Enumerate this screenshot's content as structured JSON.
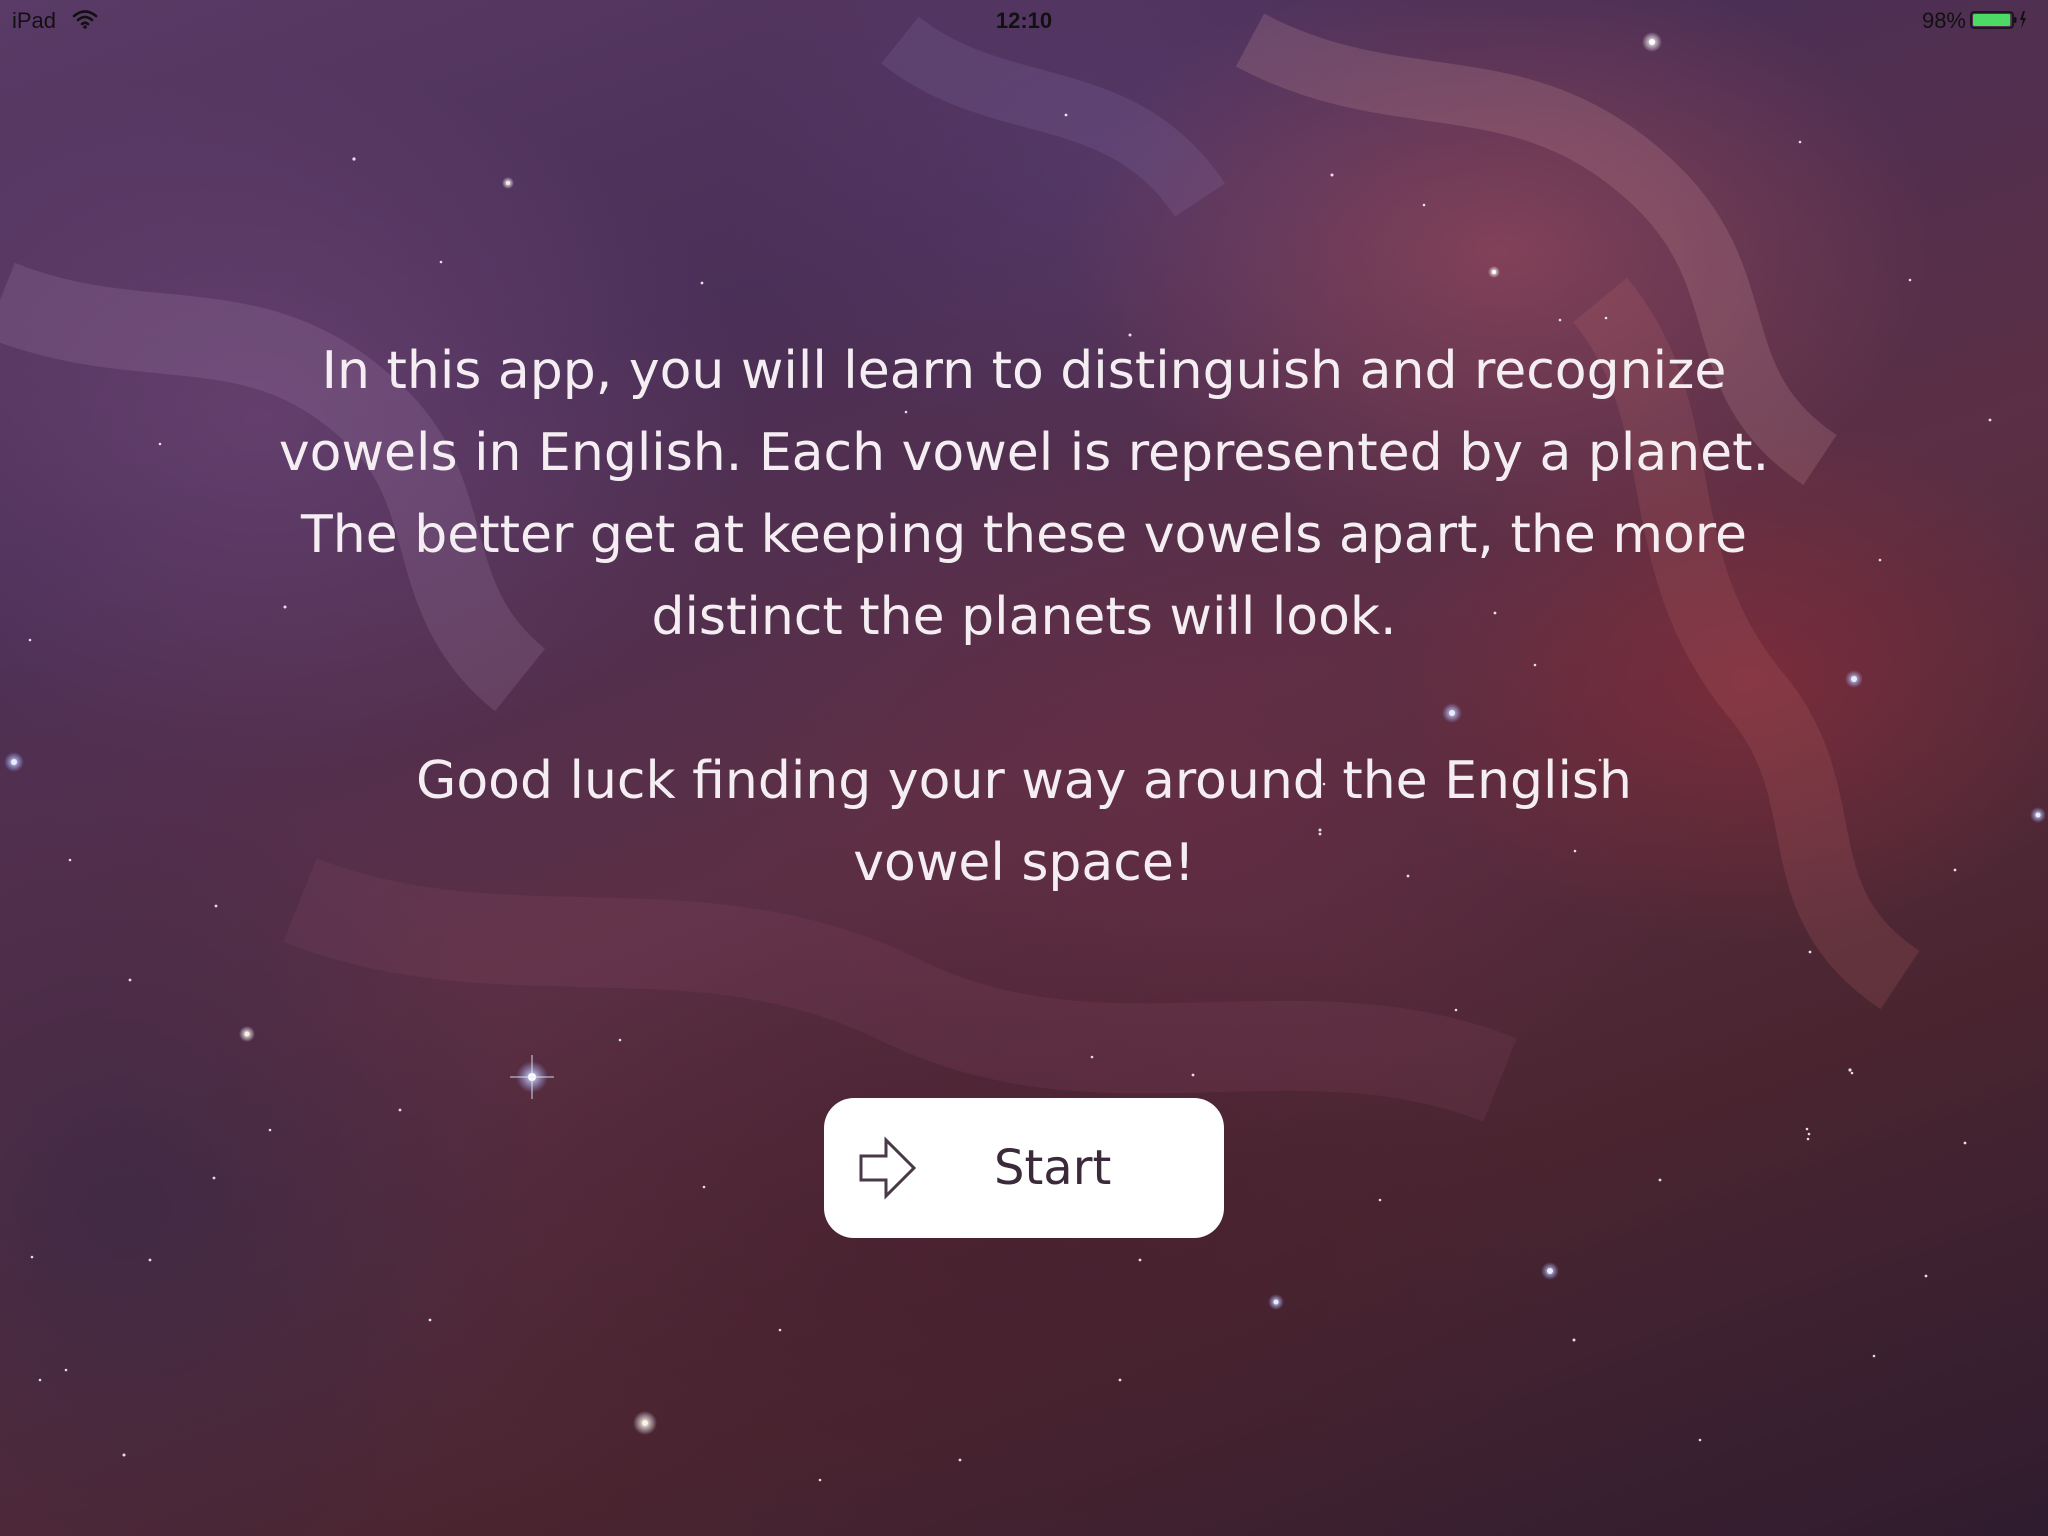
{
  "status_bar": {
    "device": "iPad",
    "time": "12:10",
    "battery_percent": "98%",
    "battery_level": 0.98,
    "battery_color": "#4cd964"
  },
  "intro": {
    "paragraph1": "In this app, you will learn to distinguish and recognize vowels in English. Each vowel is represented by a planet. The better get at keeping these vowels apart, the more distinct the planets will look.",
    "paragraph2": "Good luck finding your way around the English vowel space!"
  },
  "start_button": {
    "label": "Start",
    "icon": "arrow-right-outline-icon"
  },
  "background": {
    "description_icon": "nebula-starfield"
  }
}
